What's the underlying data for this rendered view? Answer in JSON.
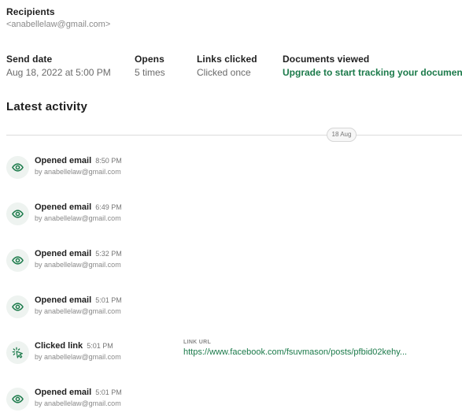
{
  "recipients": {
    "label": "Recipients",
    "value": "<anabellelaw@gmail.com>"
  },
  "stats": {
    "send_date": {
      "label": "Send date",
      "value": "Aug 18, 2022 at 5:00 PM"
    },
    "opens": {
      "label": "Opens",
      "value": "5 times"
    },
    "links_clicked": {
      "label": "Links clicked",
      "value": "Clicked once"
    },
    "documents_viewed": {
      "label": "Documents viewed",
      "value": "Upgrade to start tracking your documents"
    }
  },
  "latest_activity": {
    "title": "Latest activity",
    "date_separator": "18 Aug",
    "items": [
      {
        "icon": "eye-icon",
        "action": "Opened email",
        "time": "8:50 PM",
        "by": "by anabellelaw@gmail.com"
      },
      {
        "icon": "eye-icon",
        "action": "Opened email",
        "time": "6:49 PM",
        "by": "by anabellelaw@gmail.com"
      },
      {
        "icon": "eye-icon",
        "action": "Opened email",
        "time": "5:32 PM",
        "by": "by anabellelaw@gmail.com"
      },
      {
        "icon": "eye-icon",
        "action": "Opened email",
        "time": "5:01 PM",
        "by": "by anabellelaw@gmail.com"
      },
      {
        "icon": "click-icon",
        "action": "Clicked link",
        "time": "5:01 PM",
        "by": "by anabellelaw@gmail.com",
        "link_label": "LINK URL",
        "link_url": "https://www.facebook.com/fsuvmason/posts/pfbid02kehy..."
      },
      {
        "icon": "eye-icon",
        "action": "Opened email",
        "time": "5:01 PM",
        "by": "by anabellelaw@gmail.com"
      }
    ]
  },
  "colors": {
    "accent": "#1b7a4a",
    "icon_bg": "#eef3f0"
  }
}
